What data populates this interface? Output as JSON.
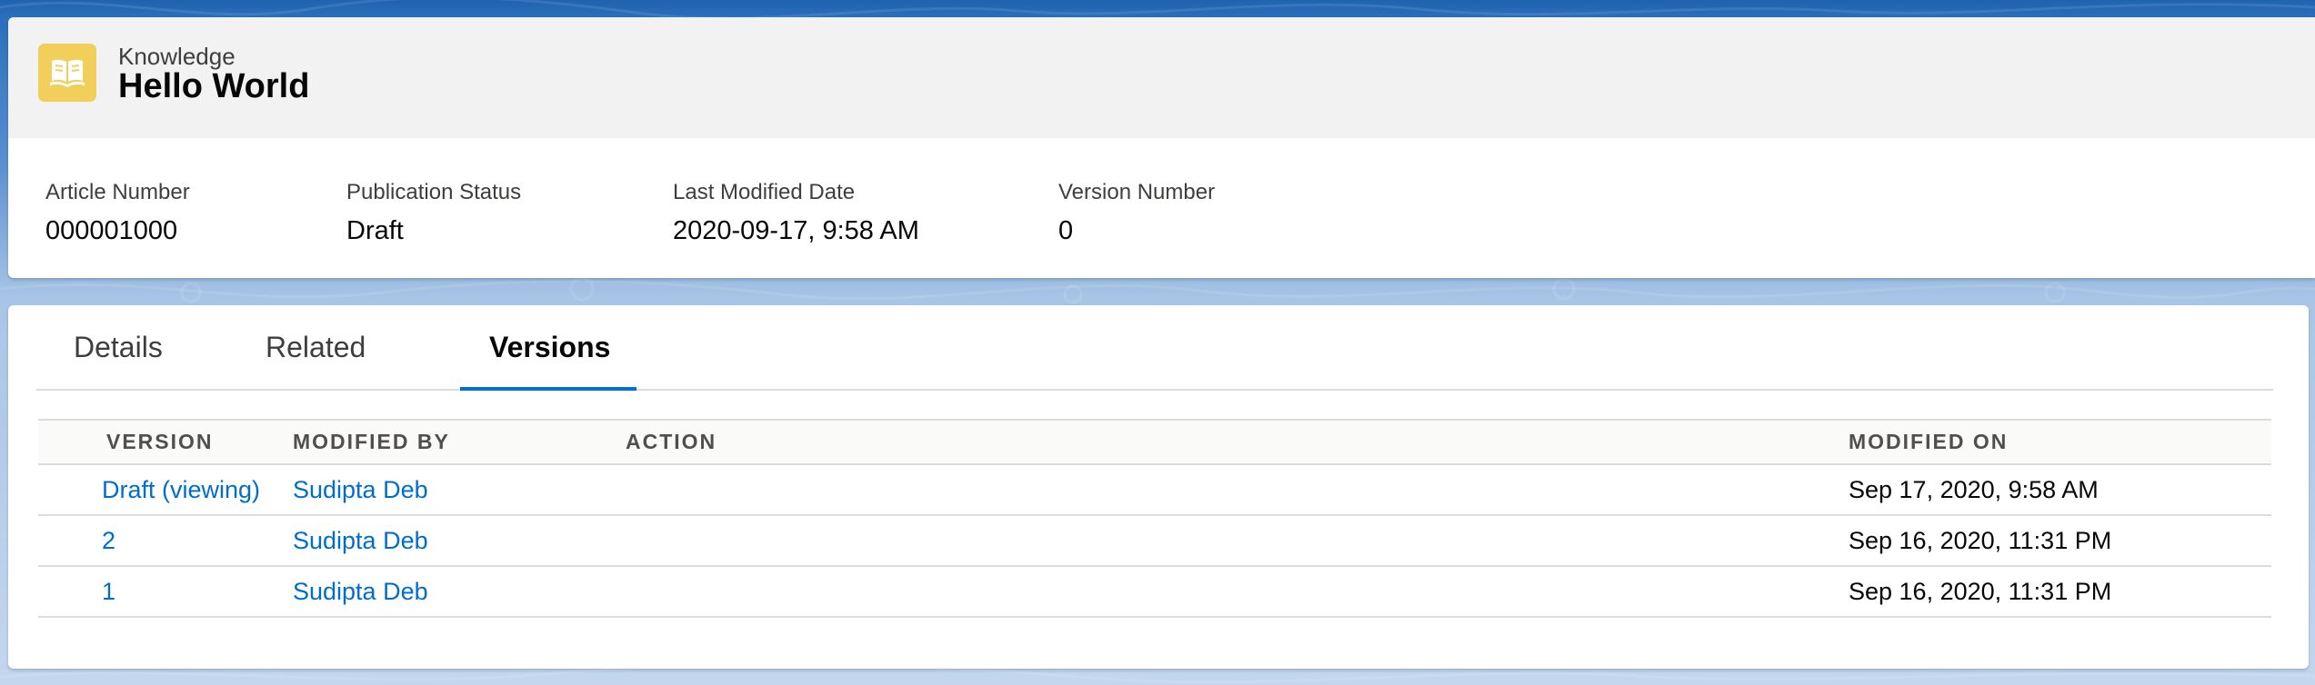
{
  "header": {
    "object_label": "Knowledge",
    "record_title": "Hello World",
    "icon": "knowledge-book-icon",
    "icon_color": "#f2cf5b"
  },
  "highlights": [
    {
      "label": "Article Number",
      "value": "000001000"
    },
    {
      "label": "Publication Status",
      "value": "Draft"
    },
    {
      "label": "Last Modified Date",
      "value": "2020-09-17, 9:58 AM"
    },
    {
      "label": "Version Number",
      "value": "0"
    }
  ],
  "tabs": [
    {
      "label": "Details",
      "active": false
    },
    {
      "label": "Related",
      "active": false
    },
    {
      "label": "Versions",
      "active": true
    }
  ],
  "versions_table": {
    "columns": [
      "VERSION",
      "MODIFIED BY",
      "ACTION",
      "MODIFIED ON"
    ],
    "rows": [
      {
        "version": "Draft (viewing)",
        "modified_by": "Sudipta Deb",
        "action": "",
        "modified_on": "Sep 17, 2020, 9:58 AM"
      },
      {
        "version": "2",
        "modified_by": "Sudipta Deb",
        "action": "",
        "modified_on": "Sep 16, 2020, 11:31 PM"
      },
      {
        "version": "1",
        "modified_by": "Sudipta Deb",
        "action": "",
        "modified_on": "Sep 16, 2020, 11:31 PM"
      }
    ]
  },
  "colors": {
    "link": "#006dcc",
    "active_tab_underline": "#0070d2",
    "background_blue": "#1f62b0"
  }
}
